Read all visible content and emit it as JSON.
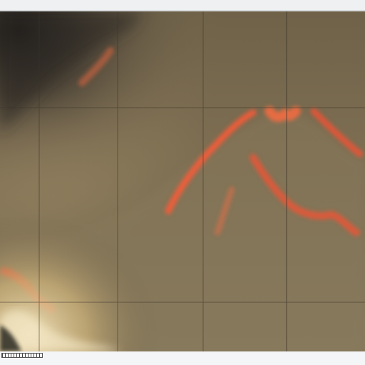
{
  "image": {
    "subject": "glowing-lava-flows-on-hillside-at-night",
    "colors": {
      "background": "#eef0f2",
      "haze": "#8a7a5c",
      "sky_dark": "#2a2620",
      "lava": "#ff4a2a",
      "glow": "#ffb070",
      "grid": "#3a342a"
    }
  }
}
